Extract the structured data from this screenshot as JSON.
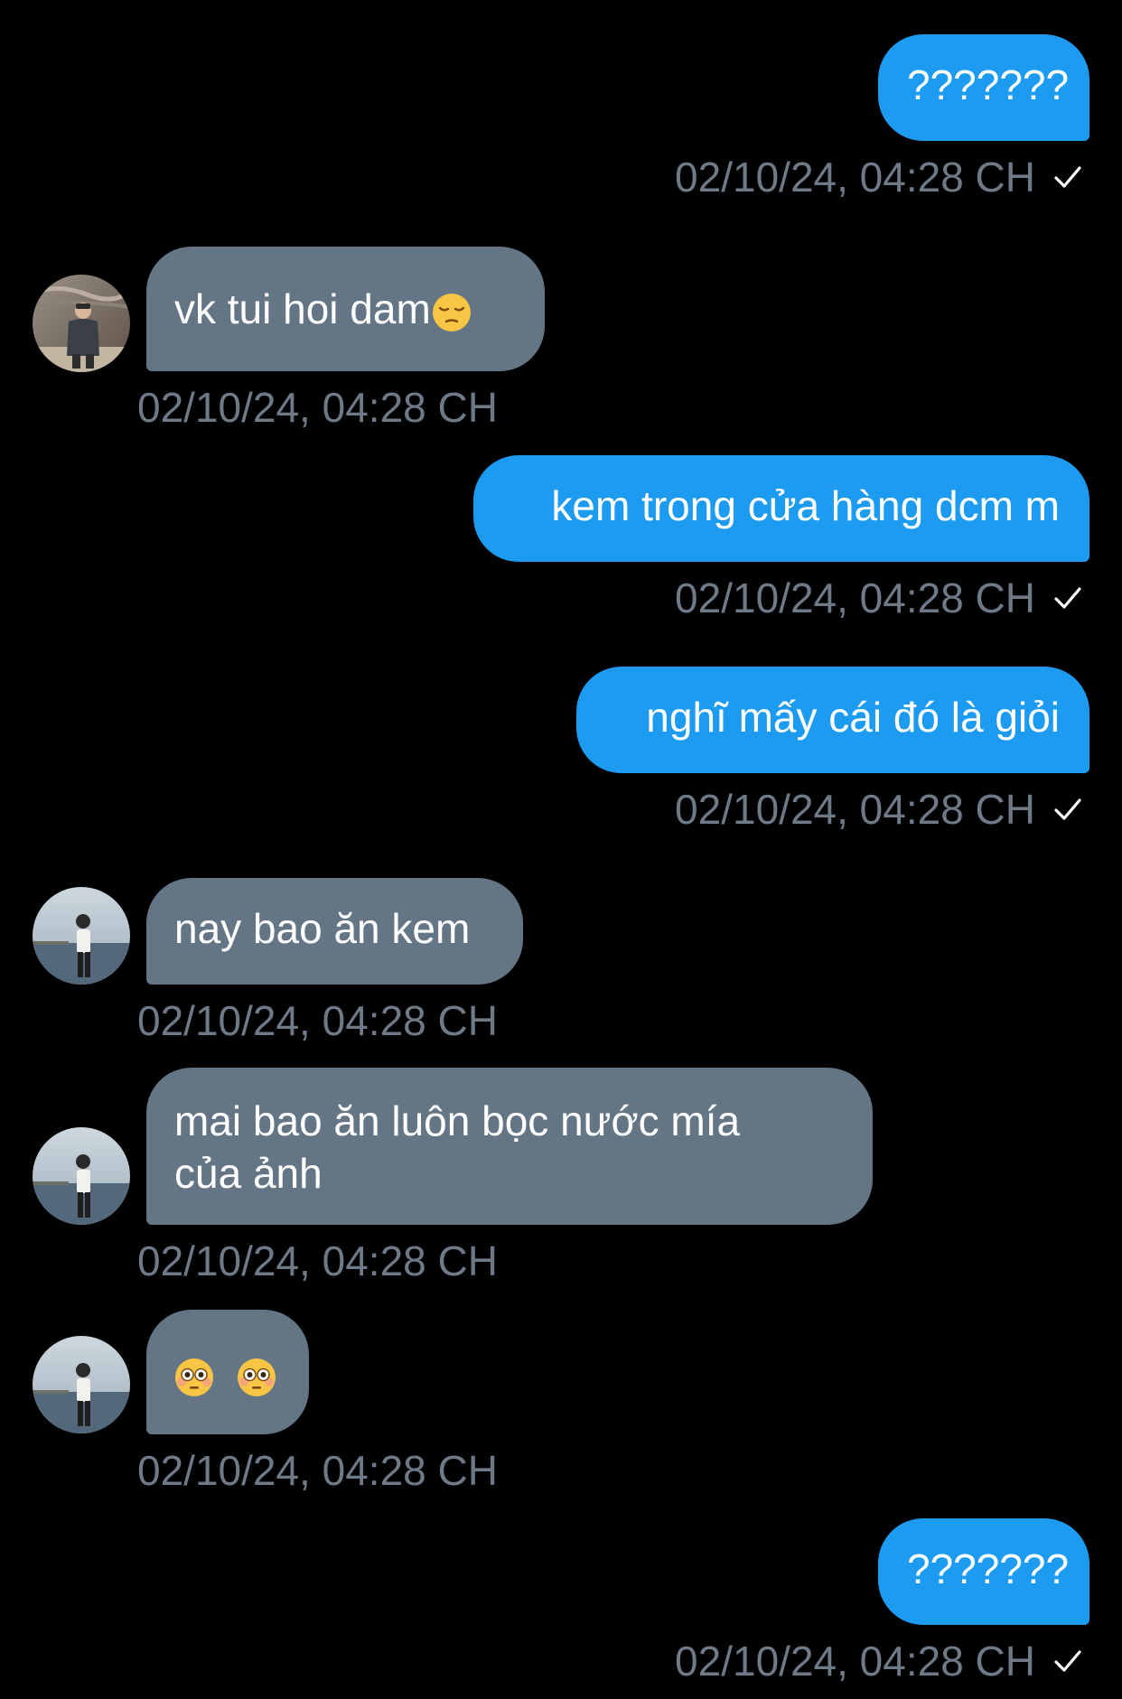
{
  "messages": [
    {
      "side": "sent",
      "text": "???????",
      "time": "02/10/24, 04:28 CH",
      "status_icon": "check-icon"
    },
    {
      "side": "received",
      "text": "vk tui hoi dam",
      "emoji": "pensive-face-emoji",
      "time": "02/10/24, 04:28 CH",
      "avatar": "avatar-user-1"
    },
    {
      "side": "sent",
      "text": "kem trong cửa hàng dcm m",
      "time": "02/10/24, 04:28 CH",
      "status_icon": "check-icon"
    },
    {
      "side": "sent",
      "text": "nghĩ mấy cái đó là giỏi",
      "time": "02/10/24, 04:28 CH",
      "status_icon": "check-icon"
    },
    {
      "side": "received",
      "text": "nay bao ăn kem",
      "time": "02/10/24, 04:28 CH",
      "avatar": "avatar-user-2"
    },
    {
      "side": "received",
      "text": "mai bao ăn luôn bọc nước mía của ảnh",
      "time": "02/10/24, 04:28 CH",
      "avatar": "avatar-user-2"
    },
    {
      "side": "received",
      "text": "",
      "emoji_pair": [
        "flushed-face-emoji",
        "flushed-face-emoji"
      ],
      "time": "02/10/24, 04:28 CH",
      "avatar": "avatar-user-2"
    },
    {
      "side": "sent",
      "text": "???????",
      "time": "02/10/24, 04:28 CH",
      "status_icon": "check-icon"
    }
  ],
  "colors": {
    "background": "#000000",
    "sent_bubble": "#1d9bf0",
    "received_bubble": "#647585",
    "timestamp": "#6e7a87",
    "text": "#ffffff"
  }
}
